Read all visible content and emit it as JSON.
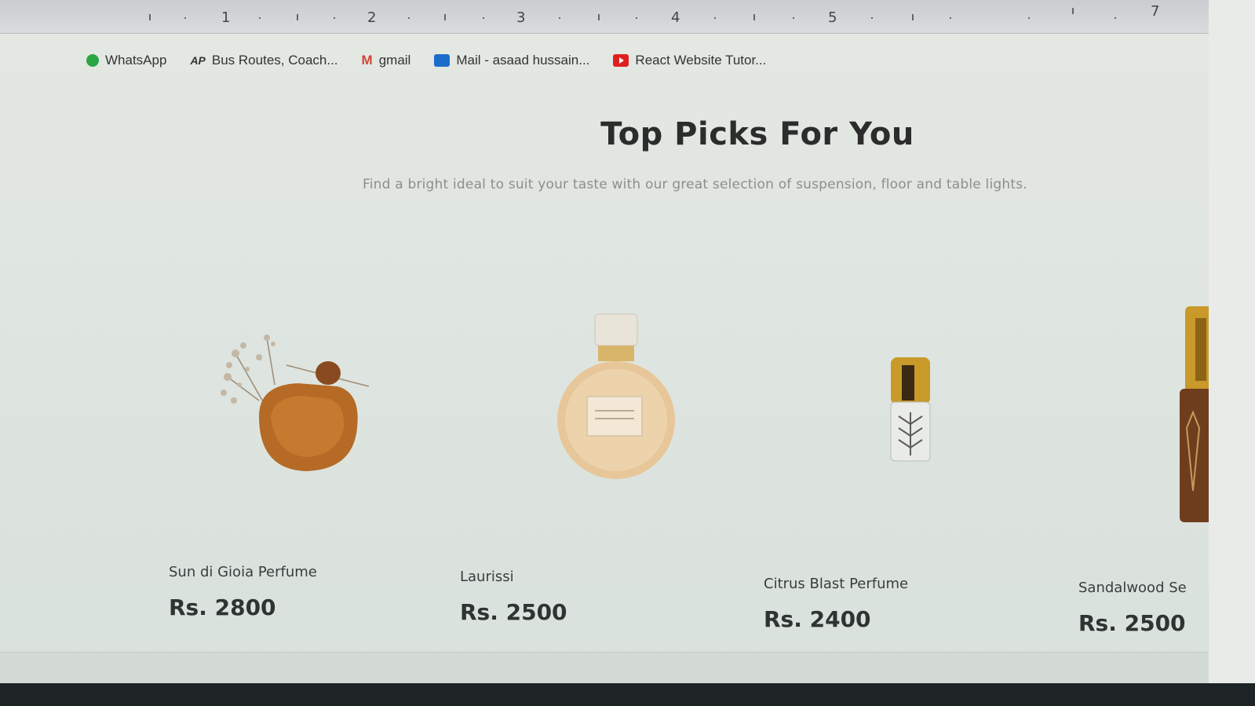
{
  "ruler": {
    "numbers": [
      "1",
      "2",
      "3",
      "4",
      "5",
      "7"
    ]
  },
  "bookmarks": [
    {
      "label": "WhatsApp",
      "icon": "whatsapp-icon"
    },
    {
      "label": "Bus Routes, Coach...",
      "icon": "ap-logo-icon"
    },
    {
      "label": "gmail",
      "icon": "gmail-icon"
    },
    {
      "label": "Mail - asaad hussain...",
      "icon": "outlook-icon"
    },
    {
      "label": "React Website Tutor...",
      "icon": "youtube-icon"
    }
  ],
  "section": {
    "title": "Top Picks For You",
    "subtitle": "Find a bright ideal to suit your taste with our great selection of suspension, floor and table lights."
  },
  "products": [
    {
      "name": "Sun di Gioia Perfume",
      "price": "Rs. 2800"
    },
    {
      "name": "Laurissi",
      "price": "Rs. 2500"
    },
    {
      "name": "Citrus Blast Perfume",
      "price": "Rs. 2400"
    },
    {
      "name": "Sandalwood Se",
      "price": "Rs. 2500"
    }
  ],
  "colors": {
    "background": "#dfe5e0",
    "heading": "#2c2c2c",
    "subtitle": "#8b8f8e",
    "price": "#2f3332"
  }
}
